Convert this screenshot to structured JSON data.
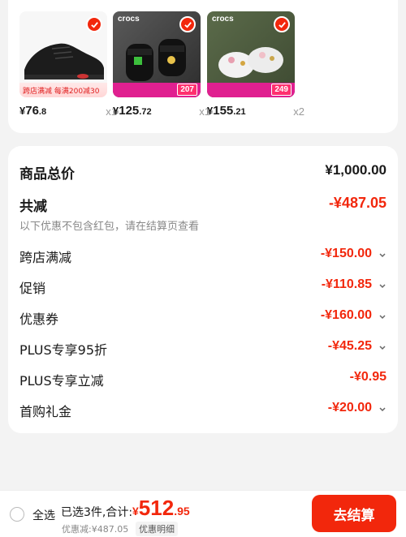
{
  "products": [
    {
      "name": "black sneaker",
      "price_int": "76",
      "price_dec": ".8",
      "currency": "¥",
      "qty": "x1",
      "banner_text": "跨店满减 每满200减30",
      "selected": true
    },
    {
      "name": "crocs black sandal",
      "brand": "crocs",
      "price_int": "125",
      "price_dec": ".72",
      "currency": "¥",
      "qty": "x1",
      "tag_price": "207",
      "selected": true
    },
    {
      "name": "crocs white clog",
      "brand": "crocs",
      "price_int": "155",
      "price_dec": ".21",
      "currency": "¥",
      "qty": "x2",
      "tag_price": "249",
      "selected": true
    }
  ],
  "summary": {
    "goods_total_label": "商品总价",
    "goods_total_value": "¥1,000.00",
    "reduction_label": "共减",
    "reduction_value": "-¥487.05",
    "reduction_note": "以下优惠不包含红包，请在结算页查看",
    "items": [
      {
        "label": "跨店满减",
        "value": "-¥150.00",
        "expandable": true
      },
      {
        "label": "促销",
        "value": "-¥110.85",
        "expandable": true
      },
      {
        "label": "优惠券",
        "value": "-¥160.00",
        "expandable": true
      },
      {
        "label": "PLUS专享95折",
        "value": "-¥45.25",
        "expandable": true
      },
      {
        "label": "PLUS专享立减",
        "value": "-¥0.95",
        "expandable": false
      },
      {
        "label": "首购礼金",
        "value": "-¥20.00",
        "expandable": true
      }
    ]
  },
  "bottom_bar": {
    "select_all_label": "全选",
    "selected_info": "已选3件,合计:",
    "total_currency": "¥",
    "total_int": "512",
    "total_dec": ".95",
    "discount_text": "优惠减:¥487.05",
    "detail_label": "优惠明细",
    "checkout_label": "去结算"
  },
  "colors": {
    "accent": "#f2270c",
    "background": "#f3f3f3",
    "card": "#ffffff"
  }
}
